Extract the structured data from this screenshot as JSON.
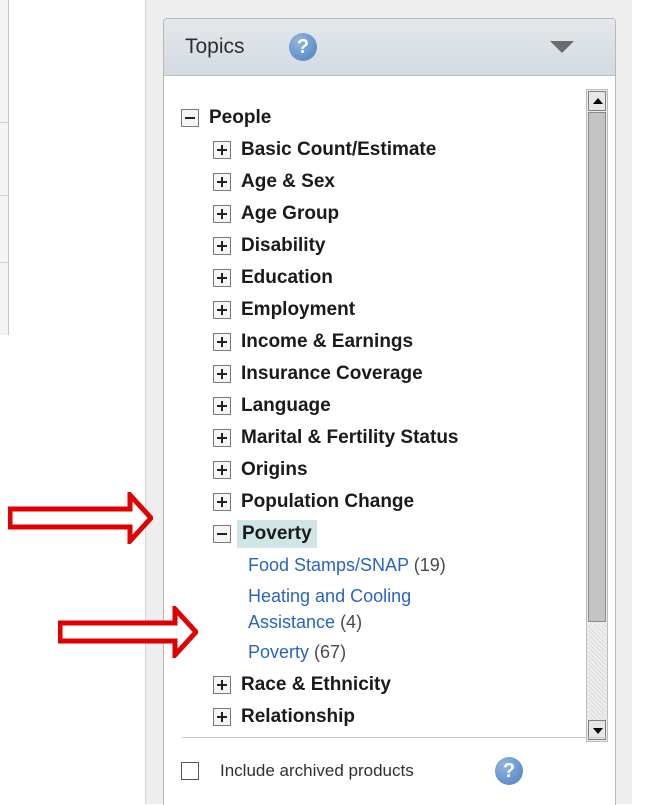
{
  "panel": {
    "title": "Topics",
    "help_symbol": "?"
  },
  "tree": {
    "root": {
      "label": "People",
      "expanded": true
    },
    "items": [
      {
        "label": "Basic Count/Estimate",
        "expanded": false
      },
      {
        "label": "Age & Sex",
        "expanded": false
      },
      {
        "label": "Age Group",
        "expanded": false
      },
      {
        "label": "Disability",
        "expanded": false
      },
      {
        "label": "Education",
        "expanded": false
      },
      {
        "label": "Employment",
        "expanded": false
      },
      {
        "label": "Income & Earnings",
        "expanded": false
      },
      {
        "label": "Insurance Coverage",
        "expanded": false
      },
      {
        "label": "Language",
        "expanded": false
      },
      {
        "label": "Marital & Fertility Status",
        "expanded": false
      },
      {
        "label": "Origins",
        "expanded": false
      },
      {
        "label": "Population Change",
        "expanded": false
      },
      {
        "label": "Poverty",
        "expanded": true,
        "selected": true
      },
      {
        "label": "Race & Ethnicity",
        "expanded": false
      },
      {
        "label": "Relationship",
        "expanded": false
      }
    ],
    "poverty_children": [
      {
        "name": "Food Stamps/SNAP",
        "count": "(19)"
      },
      {
        "name_line1": "Heating and Cooling",
        "name_line2": "Assistance",
        "count": "(4)"
      },
      {
        "name": "Poverty",
        "count": "(67)"
      }
    ]
  },
  "footer": {
    "archive_label": "Include archived products",
    "archive_checked": false,
    "help_symbol": "?"
  },
  "colors": {
    "link": "#2a63c3",
    "selected_bg": "#cfe5e6",
    "arrow": "#e00000"
  },
  "icons": [
    "help-icon",
    "collapse-arrow-icon",
    "expand-icon",
    "collapse-icon",
    "scroll-up-icon",
    "scroll-down-icon",
    "annotation-arrow-icon"
  ]
}
